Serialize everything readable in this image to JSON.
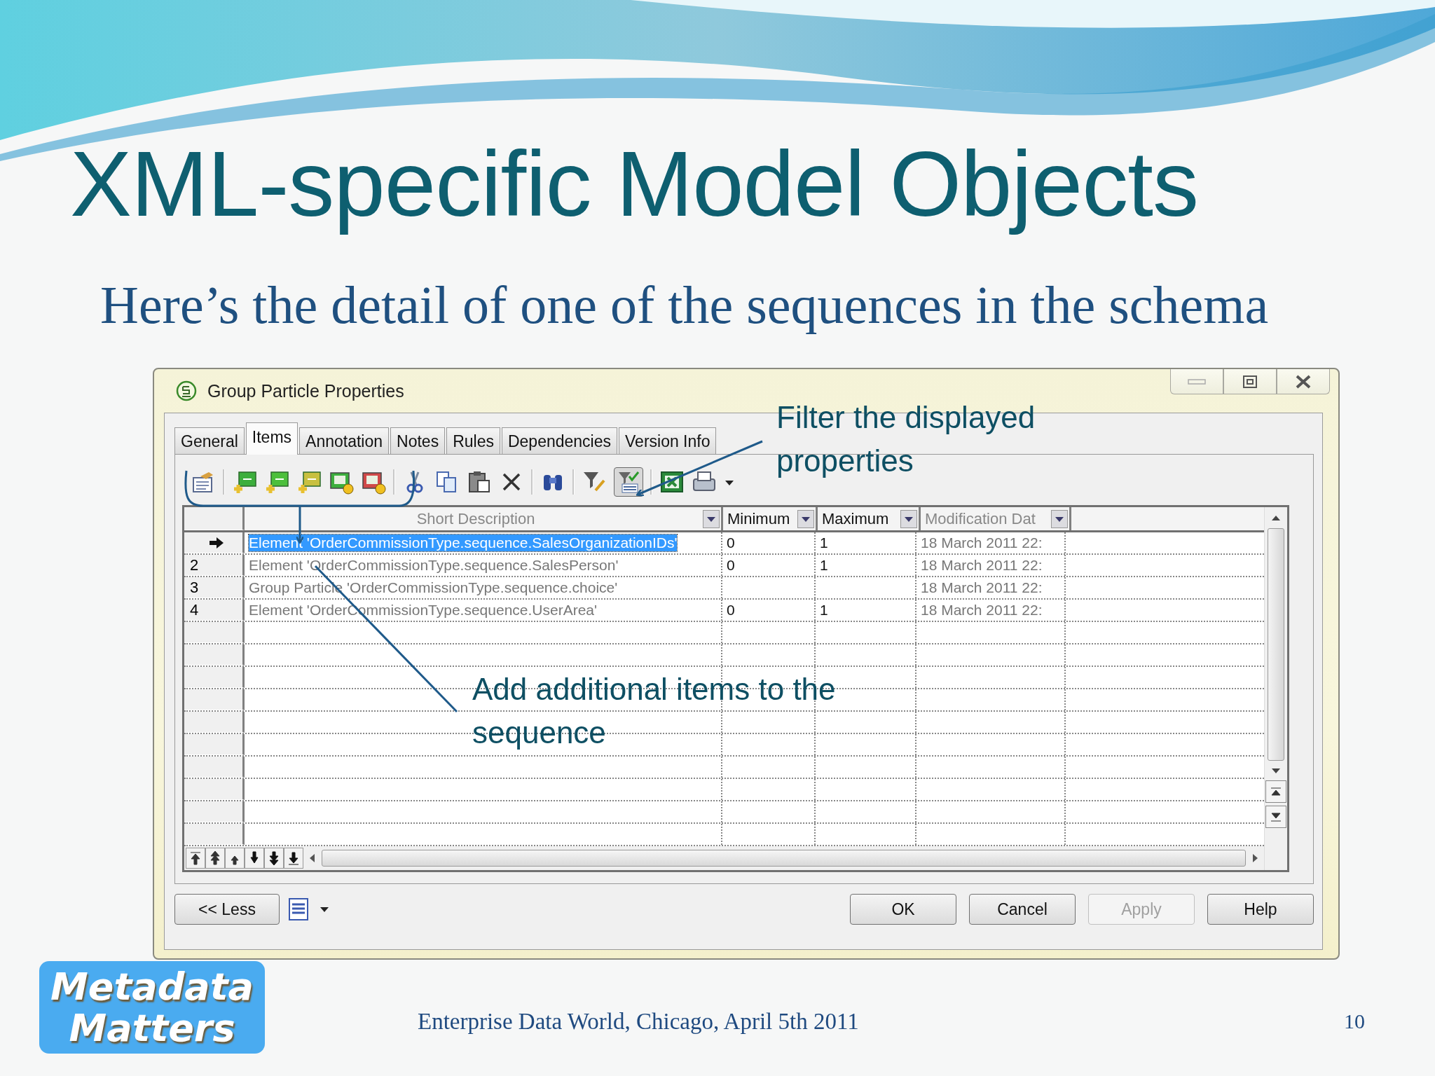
{
  "slide": {
    "title": "XML-specific Model Objects",
    "subtitle": "Here’s the detail of one of the sequences in the schema"
  },
  "window": {
    "title": "Group Particle Properties"
  },
  "tabs": [
    {
      "label": "General",
      "selected": false
    },
    {
      "label": "Items",
      "selected": true
    },
    {
      "label": "Annotation",
      "selected": false
    },
    {
      "label": "Notes",
      "selected": false
    },
    {
      "label": "Rules",
      "selected": false
    },
    {
      "label": "Dependencies",
      "selected": false
    },
    {
      "label": "Version Info",
      "selected": false
    }
  ],
  "toolbar": {
    "filter_list_pressed": true
  },
  "table": {
    "columns": [
      {
        "label": "Short Description",
        "dimmed": true
      },
      {
        "label": "Minimum",
        "dimmed": false
      },
      {
        "label": "Maximum",
        "dimmed": false
      },
      {
        "label": "Modification Dat",
        "dimmed": true
      }
    ],
    "rows": [
      {
        "selected": true,
        "cells": [
          "Element 'OrderCommissionType.sequence.SalesOrganizationIDs'",
          "0",
          "1",
          "18 March 2011 22:"
        ]
      },
      {
        "row_header": "2",
        "selected": false,
        "cells": [
          "Element 'OrderCommissionType.sequence.SalesPerson'",
          "0",
          "1",
          "18 March 2011 22:"
        ]
      },
      {
        "row_header": "3",
        "selected": false,
        "cells": [
          "Group Particle 'OrderCommissionType.sequence.choice'",
          null,
          null,
          "18 March 2011 22:"
        ]
      },
      {
        "row_header": "4",
        "selected": false,
        "cells": [
          "Element 'OrderCommissionType.sequence.UserArea'",
          "0",
          "1",
          "18 March 2011 22:"
        ]
      }
    ]
  },
  "less_button": {
    "label": "<< Less"
  },
  "buttons": [
    {
      "label": "OK",
      "disabled": false
    },
    {
      "label": "Cancel",
      "disabled": false
    },
    {
      "label": "Apply",
      "disabled": true
    },
    {
      "label": "Help",
      "disabled": false
    }
  ],
  "callouts": {
    "filter": "Filter the displayed properties",
    "add_items": "Add additional items to the sequence"
  },
  "logo": {
    "lines": [
      "Metadata",
      "Matters"
    ]
  },
  "footer": {
    "text": "Enterprise Data World, Chicago, April 5th 2011",
    "page": "10"
  }
}
